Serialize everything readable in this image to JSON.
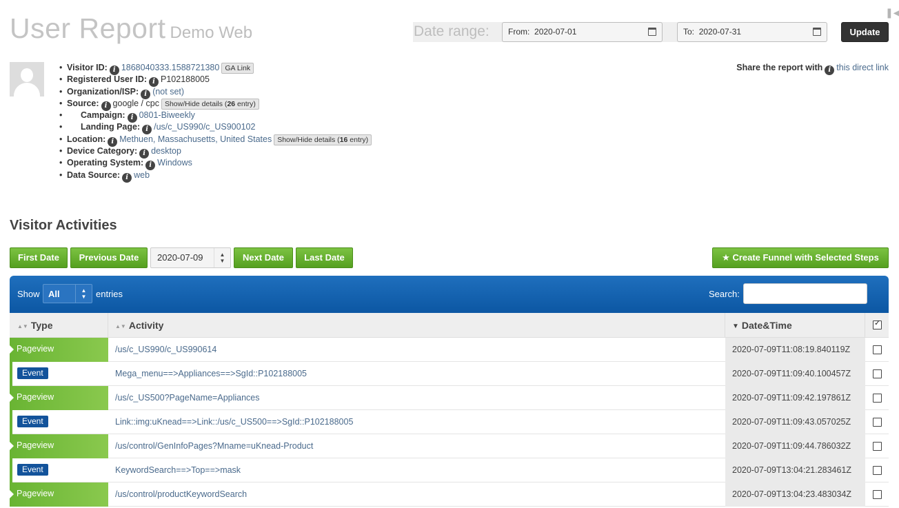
{
  "header": {
    "title": "User Report",
    "subtitle": "Demo Web"
  },
  "date_range": {
    "label": "Date range:",
    "from_prefix": "From:",
    "from_value": "2020-07-01",
    "to_prefix": "To:",
    "to_value": "2020-07-31",
    "update_label": "Update"
  },
  "share": {
    "label": "Share the report with",
    "link": "this direct link"
  },
  "info": {
    "visitor_id": {
      "label": "Visitor ID:",
      "value": "1868040333.1588721380",
      "button": "GA Link"
    },
    "registered_user_id": {
      "label": "Registered User ID:",
      "value": "P102188005"
    },
    "organization": {
      "label": "Organization/ISP:",
      "value": "(not set)"
    },
    "source": {
      "label": "Source:",
      "value": "google / cpc",
      "button_prefix": "Show/Hide details (",
      "button_count": "26",
      "button_suffix": " entry)"
    },
    "campaign": {
      "label": "Campaign:",
      "value": "0801-Biweekly"
    },
    "landing_page": {
      "label": "Landing Page:",
      "value": "/us/c_US990/c_US900102"
    },
    "location": {
      "label": "Location:",
      "value": "Methuen, Massachusetts, United States",
      "button_prefix": "Show/Hide details (",
      "button_count": "16",
      "button_suffix": " entry)"
    },
    "device_category": {
      "label": "Device Category:",
      "value": "desktop"
    },
    "operating_system": {
      "label": "Operating System:",
      "value": "Windows"
    },
    "data_source": {
      "label": "Data Source:",
      "value": "web"
    }
  },
  "activities": {
    "title": "Visitor Activities",
    "first_date": "First Date",
    "previous_date": "Previous Date",
    "current_date": "2020-07-09",
    "next_date": "Next Date",
    "last_date": "Last Date",
    "create_funnel": "★ Create Funnel with Selected Steps"
  },
  "table": {
    "show_label": "Show",
    "show_value": "All",
    "entries_label": "entries",
    "search_label": "Search:",
    "columns": [
      "Type",
      "Activity",
      "Date&Time"
    ],
    "rows": [
      {
        "type": "Pageview",
        "activity": "/us/c_US990/c_US990614",
        "datetime": "2020-07-09T11:08:19.840119Z"
      },
      {
        "type": "Event",
        "activity": "Mega_menu==>Appliances==>SgId::P102188005",
        "datetime": "2020-07-09T11:09:40.100457Z"
      },
      {
        "type": "Pageview",
        "activity": "/us/c_US500?PageName=Appliances",
        "datetime": "2020-07-09T11:09:42.197861Z"
      },
      {
        "type": "Event",
        "activity": "Link::img:uKnead==>Link::/us/c_US500==>SgId::P102188005",
        "datetime": "2020-07-09T11:09:43.057025Z"
      },
      {
        "type": "Pageview",
        "activity": "/us/control/GenInfoPages?Mname=uKnead-Product",
        "datetime": "2020-07-09T11:09:44.786032Z"
      },
      {
        "type": "Event",
        "activity": "KeywordSearch==>Top==>mask",
        "datetime": "2020-07-09T13:04:21.283461Z"
      },
      {
        "type": "Pageview",
        "activity": "/us/control/productKeywordSearch",
        "datetime": "2020-07-09T13:04:23.483034Z"
      }
    ]
  },
  "colors": {
    "pageview_green": "#69b433",
    "event_blue": "#13539b",
    "header_blue": "#1f6fbd",
    "link": "#4a6a8c"
  }
}
